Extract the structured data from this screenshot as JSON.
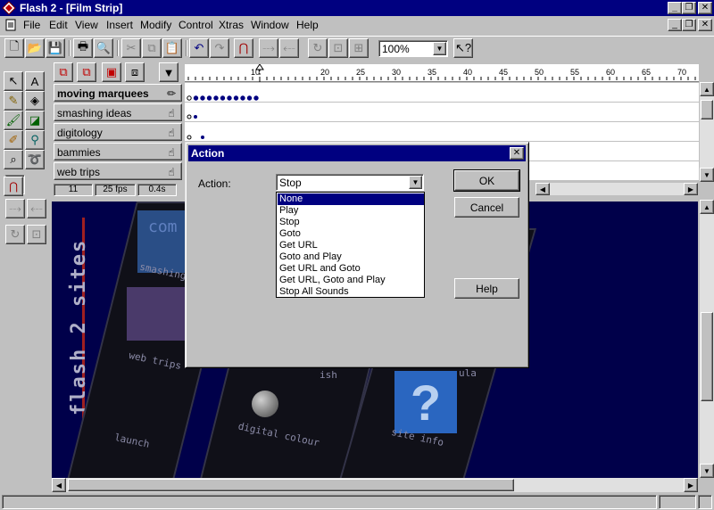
{
  "window": {
    "title": "Flash 2 - [Film Strip]"
  },
  "menu": [
    {
      "label": "File",
      "key": "F"
    },
    {
      "label": "Edit",
      "key": "E"
    },
    {
      "label": "View",
      "key": "V"
    },
    {
      "label": "Insert",
      "key": "I"
    },
    {
      "label": "Modify",
      "key": "M"
    },
    {
      "label": "Control",
      "key": "C"
    },
    {
      "label": "Xtras",
      "key": "X"
    },
    {
      "label": "Window",
      "key": "W"
    },
    {
      "label": "Help",
      "key": "H"
    }
  ],
  "toolbar": {
    "zoom": "100%"
  },
  "timeline": {
    "ruler_ticks": [
      "10",
      "20",
      "25",
      "30",
      "35",
      "40",
      "45",
      "50",
      "55",
      "60",
      "65",
      "70"
    ],
    "layers": [
      {
        "name": "moving marquees",
        "icon": "pencil-icon",
        "active": true
      },
      {
        "name": "smashing ideas",
        "icon": "hand-icon"
      },
      {
        "name": "digitology",
        "icon": "hand-icon"
      },
      {
        "name": "bammies",
        "icon": "hand-icon"
      },
      {
        "name": "web trips",
        "icon": "hand-icon"
      }
    ],
    "status": {
      "frame": "11",
      "fps": "25 fps",
      "time": "0.4s"
    }
  },
  "stage": {
    "title": "flash 2 sites",
    "labels": [
      "smashing",
      "web trips",
      "launch",
      "digital colour",
      "site info",
      "com",
      "ish",
      "ula"
    ]
  },
  "dialog": {
    "title": "Action",
    "action_label": "Action:",
    "action_value": "Stop",
    "options": [
      "None",
      "Play",
      "Stop",
      "Goto",
      "Get URL",
      "Goto and Play",
      "Get URL and Goto",
      "Get URL, Goto and Play",
      "Stop All Sounds"
    ],
    "selected_option": "None",
    "ok": "OK",
    "cancel": "Cancel",
    "help": "Help"
  },
  "colors": {
    "titlebar": "#000080",
    "face": "#c0c0c0",
    "stage": "#00004a",
    "highlight": "#000080"
  }
}
